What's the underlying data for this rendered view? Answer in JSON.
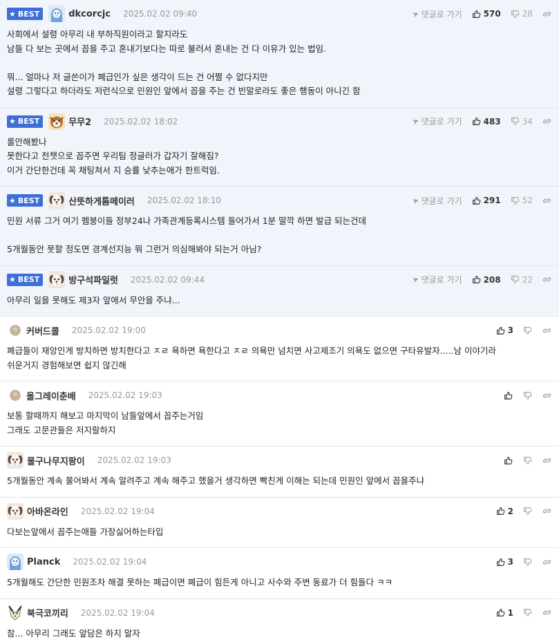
{
  "ui": {
    "best_label": "BEST",
    "reply_label": "댓글로 가기"
  },
  "comments": [
    {
      "best": true,
      "avatar": "blue-character-icon",
      "nick": "dkcorcjc",
      "date": "2025.02.02 09:40",
      "likes": "570",
      "dislikes": "28",
      "lines": [
        "사회에서 설령 아무리 내 부하직원이라고 할지라도",
        "남들 다 보는 곳에서 꼽을 주고 혼내기보다는 따로 불러서 혼내는 건 다 이유가 있는 법임.",
        "",
        "뭐... 얼마나 저 글쓴이가 폐급인가 싶은 생각이 드는 건 어쩔 수 없다지만",
        "설령 그렇다고 하더라도 저런식으로 민원인 앞에서 꼽을 주는 건 빈말로라도 좋은 행동이 아니긴 함"
      ]
    },
    {
      "best": true,
      "avatar": "dog-icon",
      "nick": "무무2",
      "date": "2025.02.02 18:02",
      "likes": "483",
      "dislikes": "34",
      "lines": [
        "롤안해봤나",
        "못한다고 전챗으로 꼽주면 우리팀 정글러가 갑자기 잘해짐?",
        "이거 간단한건데 꼭 채팅쳐서 지 승률 낮추는애가 한트럭임."
      ]
    },
    {
      "best": true,
      "avatar": "puppy-icon",
      "nick": "산뜻하게틈메이러",
      "date": "2025.02.02 18:10",
      "likes": "291",
      "dislikes": "52",
      "lines": [
        "민원 서류 그거 여기 펨붕이들 정부24나 가족관계등록시스템 들어가서 1분 딸깍 하면 발급 되는건데",
        "",
        "5개월동안 못할 정도면 경계선지능 뭐 그런거 의심해봐야 되는거 아님?"
      ]
    },
    {
      "best": true,
      "avatar": "puppy-icon",
      "nick": "방구석파일럿",
      "date": "2025.02.02 09:44",
      "likes": "208",
      "dislikes": "22",
      "lines": [
        "아무리 일을 못해도 제3자 앞에서 무안을 주냐..."
      ]
    },
    {
      "best": false,
      "avatar": "default-avatar-icon",
      "nick": "커버드콜",
      "date": "2025.02.02 19:00",
      "likes": "3",
      "dislikes": "",
      "lines": [
        "폐급들이 재앙인게 방치하면 방치한다고 ㅈㄹ 욕하면 욕한다고 ㅈㄹ 의욕만 넘치면 사고제조기 의욕도 없으면 구타유발자.....남 이야기라",
        "쉬운거지 경험해보면 쉽지 않긴해"
      ]
    },
    {
      "best": false,
      "avatar": "default-avatar-icon",
      "nick": "올그레이춘배",
      "date": "2025.02.02 19:03",
      "likes": "",
      "dislikes": "",
      "lines": [
        "보통 할때까지 해보고 마지막이 남들앞에서 꼽주는거임",
        "그래도 고문관들은 저지랄하지"
      ]
    },
    {
      "best": false,
      "avatar": "puppy-icon",
      "nick": "물구나무지팡이",
      "date": "2025.02.02 19:03",
      "likes": "",
      "dislikes": "",
      "lines": [
        "5개월동안 계속 물어봐서 계속 알려주고 계속 해주고 했을거 생각하면 빡친게 이해는 되는데 민원인 앞에서 꼽을주냐"
      ]
    },
    {
      "best": false,
      "avatar": "puppy-icon",
      "nick": "아바온라인",
      "date": "2025.02.02 19:04",
      "likes": "2",
      "dislikes": "",
      "lines": [
        "다보는앞에서 꼽주는애들 가장싫어하는타입"
      ]
    },
    {
      "best": false,
      "avatar": "blue-character-icon",
      "nick": "Planck",
      "date": "2025.02.02 19:04",
      "likes": "3",
      "dislikes": "",
      "lines": [
        "5개월해도 간단한 민원조차 해결 못하는 폐급이면 폐급이 힘든게 아니고 사수와 주변 동료가 더 힘들다 ㅋㅋ"
      ]
    },
    {
      "best": false,
      "avatar": "fox-icon",
      "nick": "북극코끼리",
      "date": "2025.02.02 19:04",
      "likes": "1",
      "dislikes": "",
      "lines": [
        "참... 아무리 그래도 앞담은 하지 말자"
      ]
    }
  ]
}
